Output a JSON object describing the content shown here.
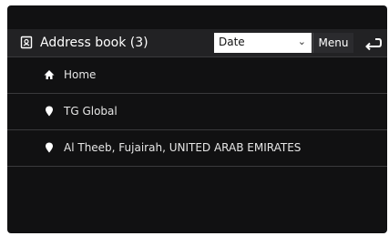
{
  "header": {
    "title_icon": "address-book-icon",
    "title": "Address book (3)",
    "sort": {
      "selected": "Date",
      "icon": "chevron-down-icon"
    },
    "menu_label": "Menu",
    "back_icon": "back-arrow-icon"
  },
  "list": {
    "items": [
      {
        "icon": "home-icon",
        "label": "Home"
      },
      {
        "icon": "location-pin-icon",
        "label": "TG Global"
      },
      {
        "icon": "location-pin-icon",
        "label": "Al Theeb, Fujairah, UNITED ARAB EMIRATES"
      }
    ]
  },
  "colors": {
    "background": "#111112",
    "header": "#222224",
    "divider": "#3a3a3c",
    "text": "#ffffff"
  }
}
